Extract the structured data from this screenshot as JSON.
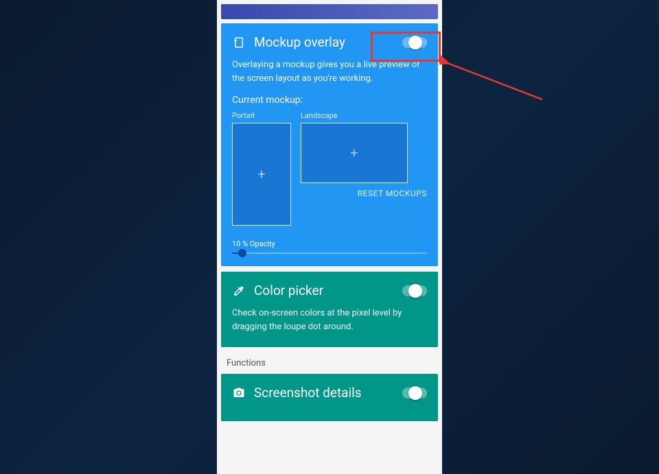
{
  "mockup_card": {
    "title": "Mockup overlay",
    "description": "Overlaying a mockup gives you a live preview of the screen layout as you're working.",
    "current_label": "Current mockup:",
    "portrait_label": "Portait",
    "landscape_label": "Landscape",
    "reset_label": "RESET MOCKUPS",
    "opacity_label": "10 % Opacity",
    "opacity_value": 10
  },
  "color_picker_card": {
    "title": "Color picker",
    "description": "Check on-screen colors at the pixel level by dragging the loupe dot around."
  },
  "section_label": "Functions",
  "screenshot_card": {
    "title": "Screenshot details"
  }
}
